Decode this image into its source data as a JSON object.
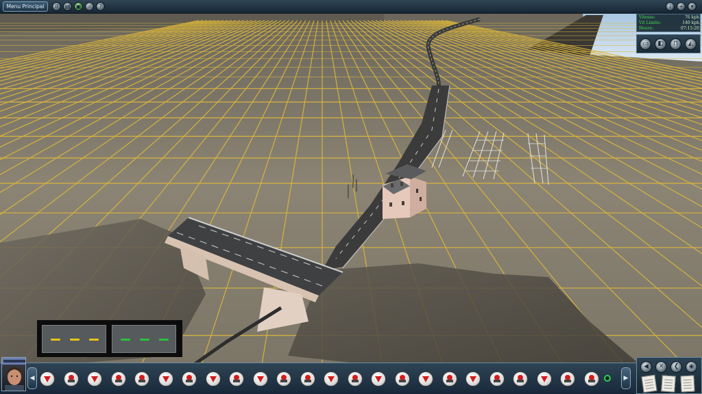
{
  "window": {
    "menu_button": "Menu Principal"
  },
  "toolbar_left": [
    {
      "icon": "pause-icon",
      "glyph": "II"
    },
    {
      "icon": "save-icon",
      "glyph": "▤"
    },
    {
      "icon": "map-icon",
      "glyph": "▣"
    },
    {
      "icon": "zoom-icon",
      "glyph": "⌕"
    },
    {
      "icon": "help-icon",
      "glyph": "?"
    }
  ],
  "toolbar_right": [
    {
      "icon": "info-icon",
      "glyph": "i"
    },
    {
      "icon": "plus-icon",
      "glyph": "+"
    },
    {
      "icon": "down-arrow-icon",
      "glyph": "▾"
    }
  ],
  "hud": {
    "speed_label": "Vitesse:",
    "speed_value": "76 kph",
    "limit_label": "Vit Limite:",
    "limit_value": "140 kph",
    "time_label": "Heure:",
    "time_value": "07:15:20"
  },
  "camera_buttons": [
    {
      "icon": "cab-view-icon",
      "glyph": "▭"
    },
    {
      "icon": "chase-view-icon",
      "glyph": "◧"
    },
    {
      "icon": "tower-view-icon",
      "glyph": "⊓"
    },
    {
      "icon": "free-view-icon",
      "glyph": "◭"
    }
  ],
  "signal_aspects": [
    {
      "color": "#e6c21a"
    },
    {
      "color": "#28c23e"
    }
  ],
  "colors": {
    "grid": "#d9b53c",
    "ground": "#7e786c",
    "hud_label": "#45e04a",
    "toolbar": "#1f3345",
    "signal_red": "#d41b1b"
  },
  "bottom_bar": {
    "left_arrow": "◀",
    "right_arrow": "▶",
    "items": [
      "signal",
      "junction",
      "signal",
      "junction",
      "junction",
      "signal",
      "junction",
      "signal",
      "junction",
      "signal",
      "junction",
      "junction",
      "signal",
      "junction",
      "signal",
      "junction",
      "signal",
      "junction",
      "signal",
      "junction",
      "junction",
      "signal",
      "junction",
      "junction"
    ]
  },
  "bottom_right_buttons": [
    {
      "icon": "back-icon",
      "glyph": "◀"
    },
    {
      "icon": "tools-icon",
      "glyph": "✕"
    },
    {
      "icon": "left-icon",
      "glyph": "❮"
    },
    {
      "icon": "eye-icon",
      "glyph": "◉"
    }
  ]
}
